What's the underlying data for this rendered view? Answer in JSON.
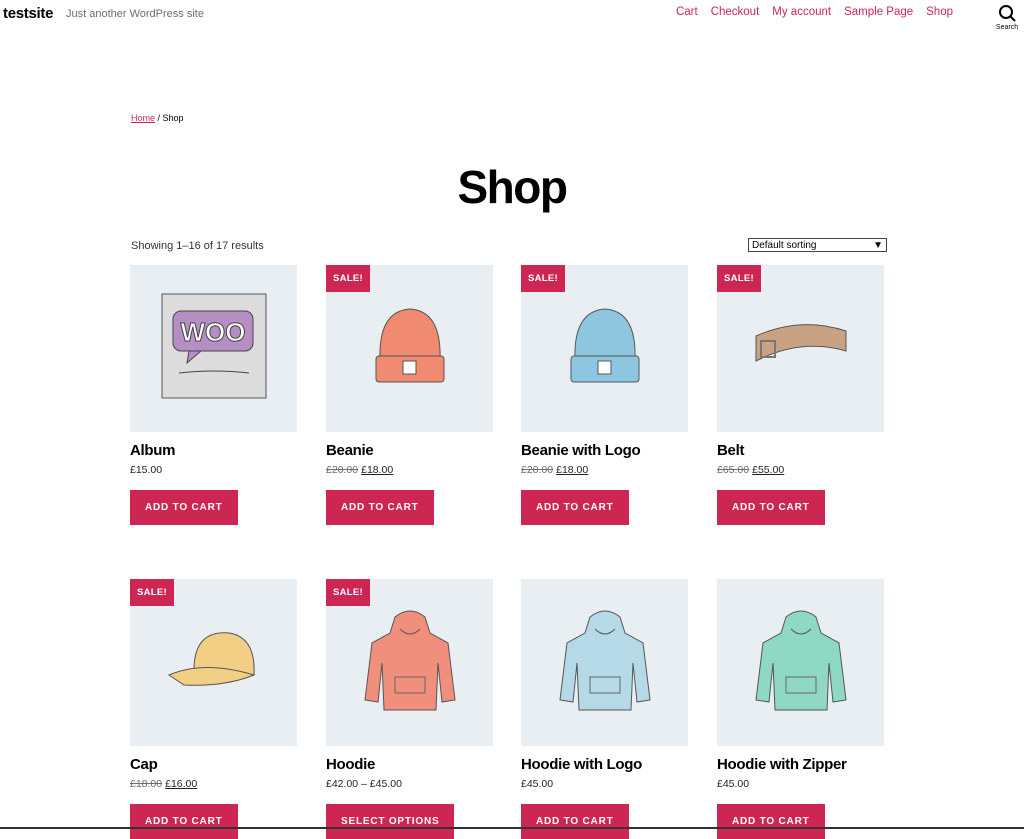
{
  "site": {
    "title": "testsite",
    "tagline": "Just another WordPress site"
  },
  "nav": [
    "Cart",
    "Checkout",
    "My account",
    "Sample Page",
    "Shop"
  ],
  "search_label": "Search",
  "breadcrumb": {
    "home": "Home",
    "sep": " / ",
    "current": "Shop"
  },
  "page_title": "Shop",
  "result_count": "Showing 1–16 of 17 results",
  "sorting": "Default sorting",
  "accent": "#cd2653",
  "products": [
    {
      "name": "Album",
      "price": "£15.00",
      "old": "",
      "sale": false,
      "button": "ADD TO CART",
      "image": "album",
      "color": "#d4d4d4"
    },
    {
      "name": "Beanie",
      "price": "£18.00",
      "old": "£20.00",
      "sale": true,
      "button": "ADD TO CART",
      "image": "beanie",
      "color": "#f08a70"
    },
    {
      "name": "Beanie with Logo",
      "price": "£18.00",
      "old": "£20.00",
      "sale": true,
      "button": "ADD TO CART",
      "image": "beanie",
      "color": "#8ec6df"
    },
    {
      "name": "Belt",
      "price": "£55.00",
      "old": "£65.00",
      "sale": true,
      "button": "ADD TO CART",
      "image": "belt",
      "color": "#c9a283"
    },
    {
      "name": "Cap",
      "price": "£16.00",
      "old": "£18.00",
      "sale": true,
      "button": "ADD TO CART",
      "image": "cap",
      "color": "#f3cf86"
    },
    {
      "name": "Hoodie",
      "price": "£42.00 – £45.00",
      "old": "",
      "sale": true,
      "button": "SELECT OPTIONS",
      "image": "hoodie",
      "color": "#f0907c"
    },
    {
      "name": "Hoodie with Logo",
      "price": "£45.00",
      "old": "",
      "sale": false,
      "button": "ADD TO CART",
      "image": "hoodie",
      "color": "#b6d9e8"
    },
    {
      "name": "Hoodie with Zipper",
      "price": "£45.00",
      "old": "",
      "sale": false,
      "button": "ADD TO CART",
      "image": "hoodie",
      "color": "#8fd8c4"
    }
  ],
  "sale_label": "SALE!",
  "woo_text": "WOO"
}
